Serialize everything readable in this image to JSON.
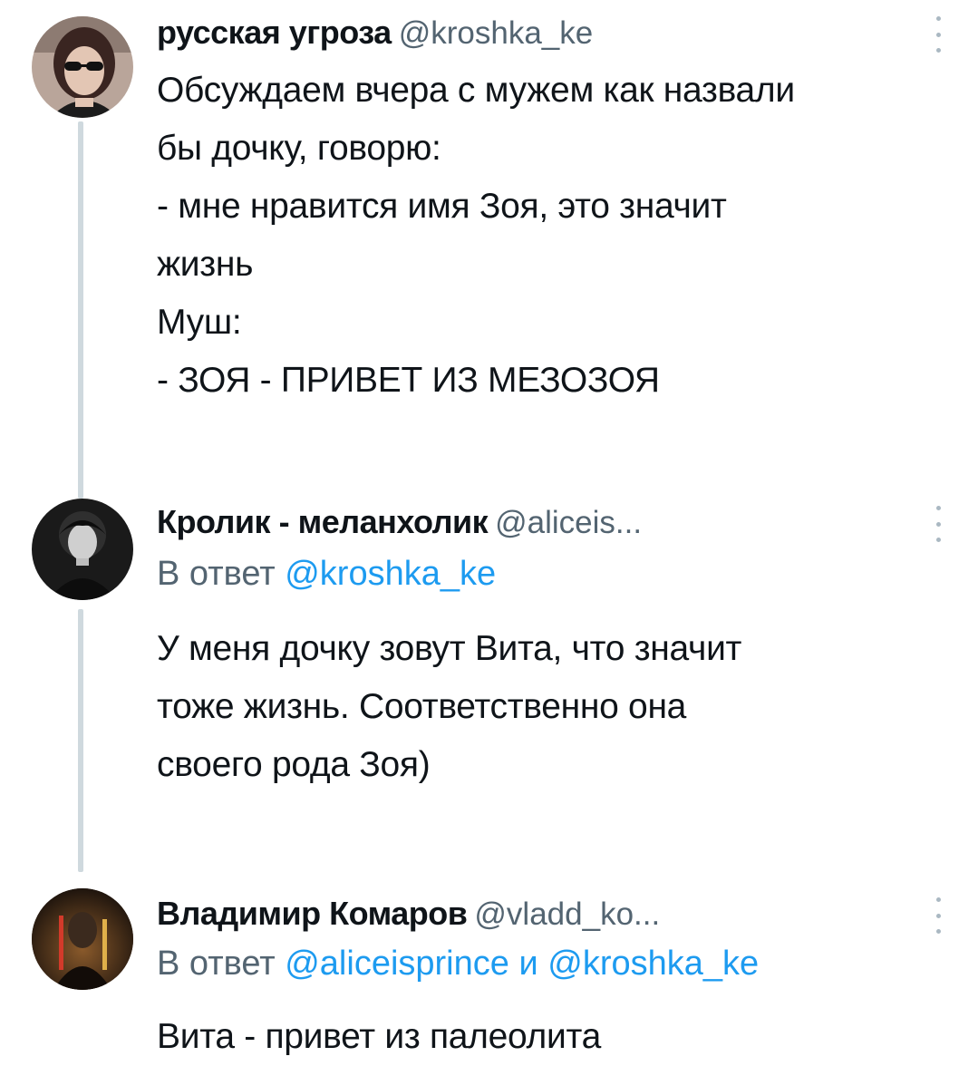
{
  "tweets": [
    {
      "display_name": "русская угроза",
      "handle": "@kroshka_ke",
      "body": [
        "Обсуждаем вчера с мужем как назвали",
        "бы дочку, говорю:",
        "- мне нравится имя Зоя, это значит",
        "жизнь",
        "Муш:",
        "- ЗОЯ - ПРИВЕТ ИЗ МЕЗОЗОЯ"
      ]
    },
    {
      "display_name": "Кролик - меланхолик",
      "handle": "@aliceis...",
      "reply_prefix": "В ответ",
      "reply_mention_1": "@kroshka_ke",
      "body": [
        "У меня дочку зовут Вита, что значит",
        "тоже жизнь. Соответственно она",
        "своего рода Зоя)"
      ]
    },
    {
      "display_name": "Владимир Комаров",
      "handle": "@vladd_ko...",
      "reply_prefix": "В ответ",
      "reply_mention_1": "@aliceisprince",
      "reply_joiner": "и",
      "reply_mention_2": "@kroshka_ke",
      "body": [
        "Вита - привет из палеолита"
      ]
    }
  ],
  "icons": {
    "more": "vertical-ellipsis-icon"
  },
  "colors": {
    "text": "#0f1419",
    "secondary": "#536471",
    "link": "#1d9bf0",
    "thread_line": "#cfd9de"
  }
}
